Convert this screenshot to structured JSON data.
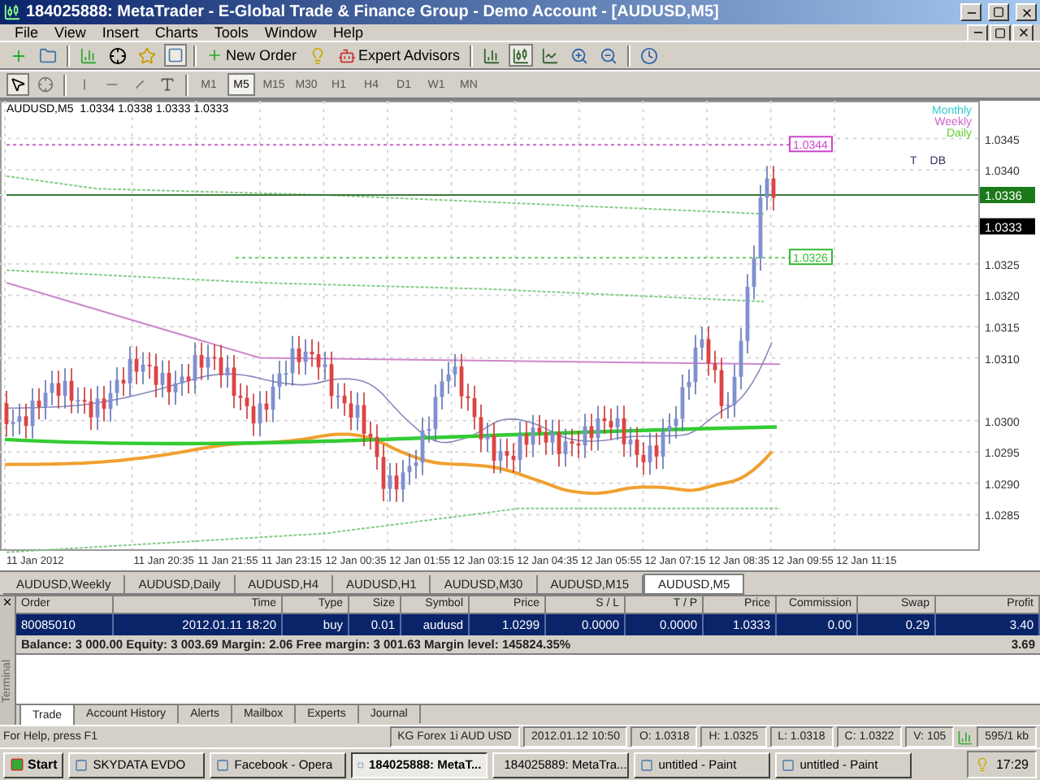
{
  "window": {
    "title": "184025888: MetaTrader - E-Global Trade & Finance Group - Demo Account - [AUDUSD,M5]"
  },
  "menu": [
    "File",
    "View",
    "Insert",
    "Charts",
    "Tools",
    "Window",
    "Help"
  ],
  "toolbar": {
    "new_order": "New Order",
    "expert_advisors": "Expert Advisors"
  },
  "timeframes": [
    {
      "label": "M1",
      "selected": false
    },
    {
      "label": "M5",
      "selected": true
    },
    {
      "label": "M15",
      "selected": false
    },
    {
      "label": "M30",
      "selected": false
    },
    {
      "label": "H1",
      "selected": false
    },
    {
      "label": "H4",
      "selected": false
    },
    {
      "label": "D1",
      "selected": false
    },
    {
      "label": "W1",
      "selected": false
    },
    {
      "label": "MN",
      "selected": false
    }
  ],
  "chart": {
    "header": "AUDUSD,M5  1.0334 1.0338 1.0333 1.0333",
    "legend": [
      {
        "text": "Monthly",
        "color": "#33cccc"
      },
      {
        "text": "Weekly",
        "color": "#cc66cc"
      },
      {
        "text": "Daily",
        "color": "#66cc33"
      }
    ],
    "markers": [
      "T",
      "DB"
    ],
    "level_tags": [
      {
        "text": "1.0344",
        "color": "#cc44cc"
      },
      {
        "text": "1.0326",
        "color": "#33bb33"
      }
    ],
    "price_axis": [
      {
        "text": "1.0345",
        "kind": "tick"
      },
      {
        "text": "1.0340",
        "kind": "tick"
      },
      {
        "text": "1.0336",
        "kind": "current"
      },
      {
        "text": "1.0333",
        "kind": "bid"
      },
      {
        "text": "1.0325",
        "kind": "tick"
      },
      {
        "text": "1.0320",
        "kind": "tick"
      },
      {
        "text": "1.0315",
        "kind": "tick"
      },
      {
        "text": "1.0310",
        "kind": "tick"
      },
      {
        "text": "1.0300",
        "kind": "tick"
      },
      {
        "text": "1.0295",
        "kind": "tick"
      },
      {
        "text": "1.0290",
        "kind": "tick"
      },
      {
        "text": "1.0285",
        "kind": "tick"
      }
    ],
    "time_axis": [
      "11 Jan 2012",
      "11 Jan 20:35",
      "11 Jan 21:55",
      "11 Jan 23:15",
      "12 Jan 00:35",
      "12 Jan 01:55",
      "12 Jan 03:15",
      "12 Jan 04:35",
      "12 Jan 05:55",
      "12 Jan 07:15",
      "12 Jan 08:35",
      "12 Jan 09:55",
      "12 Jan 11:15"
    ]
  },
  "chart_tabs": [
    {
      "label": "AUDUSD,Weekly",
      "selected": false
    },
    {
      "label": "AUDUSD,Daily",
      "selected": false
    },
    {
      "label": "AUDUSD,H4",
      "selected": false
    },
    {
      "label": "AUDUSD,H1",
      "selected": false
    },
    {
      "label": "AUDUSD,M30",
      "selected": false
    },
    {
      "label": "AUDUSD,M15",
      "selected": false
    },
    {
      "label": "AUDUSD,M5",
      "selected": true
    }
  ],
  "terminal": {
    "label": "Terminal",
    "columns": [
      "Order",
      "Time",
      "Type",
      "Size",
      "Symbol",
      "Price",
      "S / L",
      "T / P",
      "Price",
      "Commission",
      "Swap",
      "Profit"
    ],
    "rows": [
      {
        "selected": true,
        "cells": [
          "80085010",
          "2012.01.11 18:20",
          "buy",
          "0.01",
          "audusd",
          "1.0299",
          "0.0000",
          "0.0000",
          "1.0333",
          "0.00",
          "0.29",
          "3.40"
        ]
      }
    ],
    "balance": "Balance: 3 000.00  Equity: 3 003.69  Margin: 2.06  Free margin: 3 001.63  Margin level: 145824.35%",
    "total": "3.69",
    "tabs": [
      {
        "label": "Trade",
        "selected": true
      },
      {
        "label": "Account History",
        "selected": false
      },
      {
        "label": "Alerts",
        "selected": false
      },
      {
        "label": "Mailbox",
        "selected": false
      },
      {
        "label": "Experts",
        "selected": false
      },
      {
        "label": "Journal",
        "selected": false
      }
    ]
  },
  "status_bar": {
    "help": "For Help, press F1",
    "fields": [
      "KG Forex 1i AUD USD",
      "2012.01.12 10:50",
      "O: 1.0318",
      "H: 1.0325",
      "L: 1.0318",
      "C: 1.0322",
      "V: 105"
    ],
    "traffic": "595/1 kb"
  },
  "taskbar": {
    "start": "Start",
    "items": [
      {
        "label": "SKYDATA  EVDO",
        "selected": false
      },
      {
        "label": "Facebook - Opera",
        "selected": false
      },
      {
        "label": "184025888: MetaT...",
        "selected": true
      },
      {
        "label": "184025889: MetaTra...",
        "selected": false
      },
      {
        "label": "untitled - Paint",
        "selected": false
      },
      {
        "label": "untitled - Paint",
        "selected": false
      }
    ],
    "clock": "17:29"
  }
}
